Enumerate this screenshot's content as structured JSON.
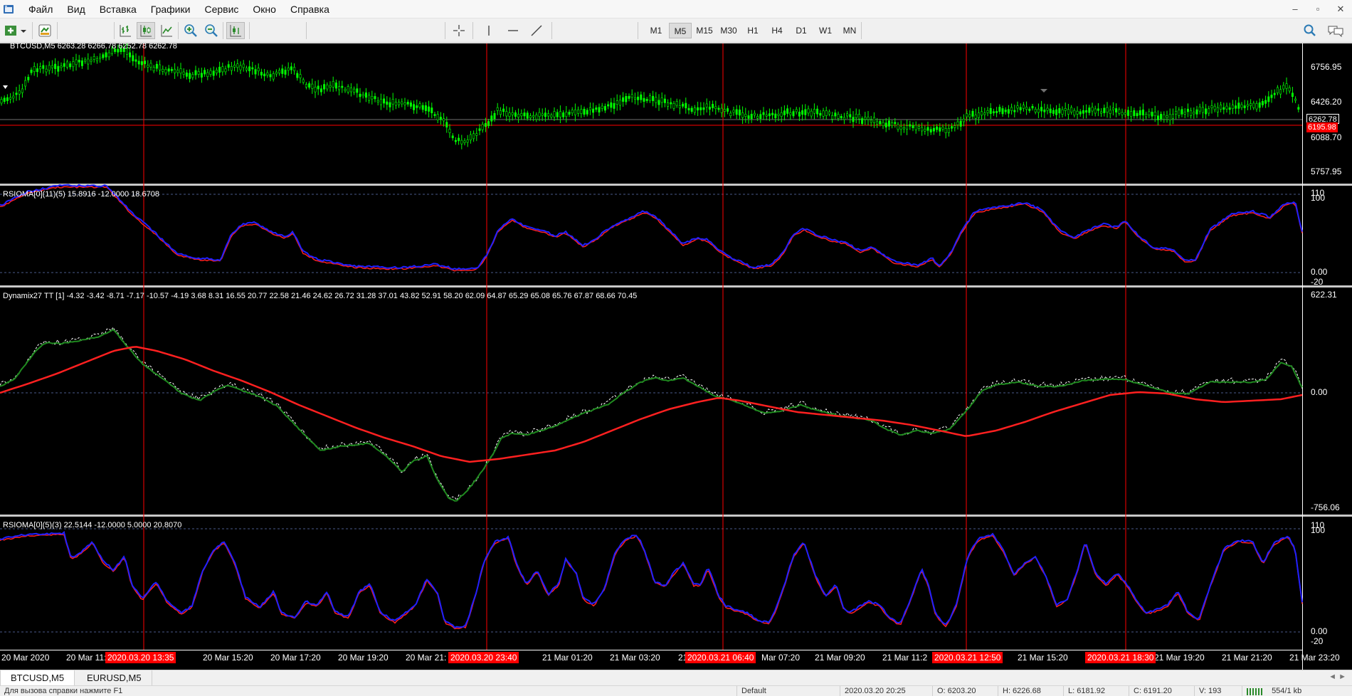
{
  "menu": {
    "items": [
      "Файл",
      "Вид",
      "Вставка",
      "Графики",
      "Сервис",
      "Окно",
      "Справка"
    ]
  },
  "window_controls": {
    "minimize": "–",
    "restore": "▫",
    "close": "✕"
  },
  "toolbar": {
    "timeframes": [
      "M1",
      "M5",
      "M15",
      "M30",
      "H1",
      "H4",
      "D1",
      "W1",
      "MN"
    ],
    "active_timeframe": "M5"
  },
  "chart": {
    "main_panel": {
      "label": "BTCUSD,M5  6263.28 6266.78 6252.78 6262.78",
      "price_axis": [
        "6756.95",
        "6426.20",
        "6262.78",
        "6195.98",
        "6088.70",
        "5757.95"
      ],
      "bid_tag": "6262.78",
      "line_tag": "6195.98",
      "colors": {
        "candle": "#00ff00",
        "line_tag_bg": "#ff0000",
        "bid_tag_bg": "#000000"
      }
    },
    "rsioma1": {
      "label": "RSIOMA[0](11)(5) 15.8916 -12.0000 18.6708",
      "axis": [
        "110",
        "100",
        "0.00",
        "-20"
      ]
    },
    "dynamix": {
      "label": "Dynamix27 TT [1] -4.32 -3.42 -8.71 -7.17 -10.57 -4.19 3.68 8.31 16.55 20.77 22.58 21.46 24.62 26.72 31.28 37.01 43.82 52.91 58.20 62.09 64.87 65.29 65.08 65.76 67.87 68.66 70.45",
      "axis": [
        "622.31",
        "0.00",
        "-756.06"
      ]
    },
    "rsioma2": {
      "label": "RSIOMA[0](5)(3) 22.5144 -12.0000 5.0000 20.8070",
      "axis": [
        "110",
        "100",
        "0.00",
        "-20"
      ]
    },
    "time_axis": [
      "20 Mar 2020",
      "20 Mar 11:",
      "20 Mar 15:20",
      "20 Mar 17:20",
      "20 Mar 19:20",
      "20 Mar 21:",
      "21 Mar 01:20",
      "21 Mar 03:20",
      "21",
      "Mar 07:20",
      "21 Mar 09:20",
      "21 Mar 11:2",
      "21 Mar 15:20",
      "21 Mar 19:20",
      "21 Mar 21:20",
      "21 Mar 23:20"
    ],
    "time_markers": [
      "2020.03.20 13:35",
      "2020.03.20 23:40",
      "2020.03.21 06:40",
      "2020.03.21 12:50",
      "2020.03.21 18:30"
    ]
  },
  "tabs": [
    {
      "label": "BTCUSD,M5",
      "active": true
    },
    {
      "label": "EURUSD,M5",
      "active": false
    }
  ],
  "status": {
    "hint": "Для вызова справки нажмите F1",
    "profile": "Default",
    "datetime": "2020.03.20 20:25",
    "open": "O: 6203.20",
    "high": "H: 6226.68",
    "low": "L: 6181.92",
    "close": "C: 6191.20",
    "volume": "V: 193",
    "traffic": "554/1 kb"
  }
}
